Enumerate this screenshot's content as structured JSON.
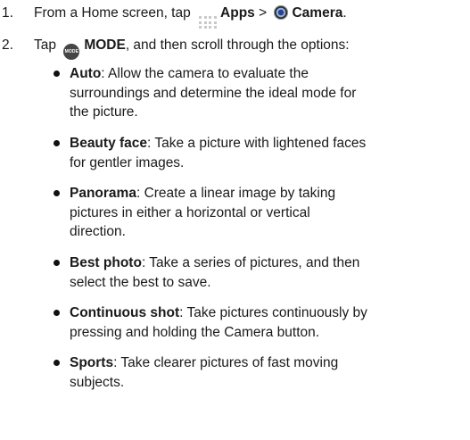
{
  "steps": [
    {
      "number": "1.",
      "pre": "From a Home screen, tap",
      "icon1": "apps-grid-icon",
      "label1": "Apps",
      "separator": ">",
      "icon2": "camera-app-icon",
      "label2": "Camera",
      "post": "."
    },
    {
      "number": "2.",
      "pre": "Tap",
      "icon": "mode-button-icon",
      "icon_text": "MODE",
      "label": "MODE",
      "post": ", and then scroll through the options:"
    }
  ],
  "modes": [
    {
      "name": "Auto",
      "desc_lines": [
        ": Allow the camera to evaluate the",
        "surroundings and determine the ideal mode for",
        "the picture."
      ]
    },
    {
      "name": "Beauty face",
      "desc_lines": [
        ": Take a picture with lightened faces",
        "for gentler images."
      ]
    },
    {
      "name": "Panorama",
      "desc_lines": [
        ": Create a linear image by taking",
        "pictures in either a horizontal or vertical",
        "direction."
      ]
    },
    {
      "name": "Best photo",
      "desc_lines": [
        ": Take a series of pictures, and then",
        "select the best to save."
      ]
    },
    {
      "name": "Continuous shot",
      "desc_lines": [
        ": Take pictures continuously by",
        "pressing and holding the Camera button."
      ]
    },
    {
      "name": "Sports",
      "desc_lines": [
        ": Take clearer pictures of fast moving",
        "subjects."
      ]
    }
  ]
}
